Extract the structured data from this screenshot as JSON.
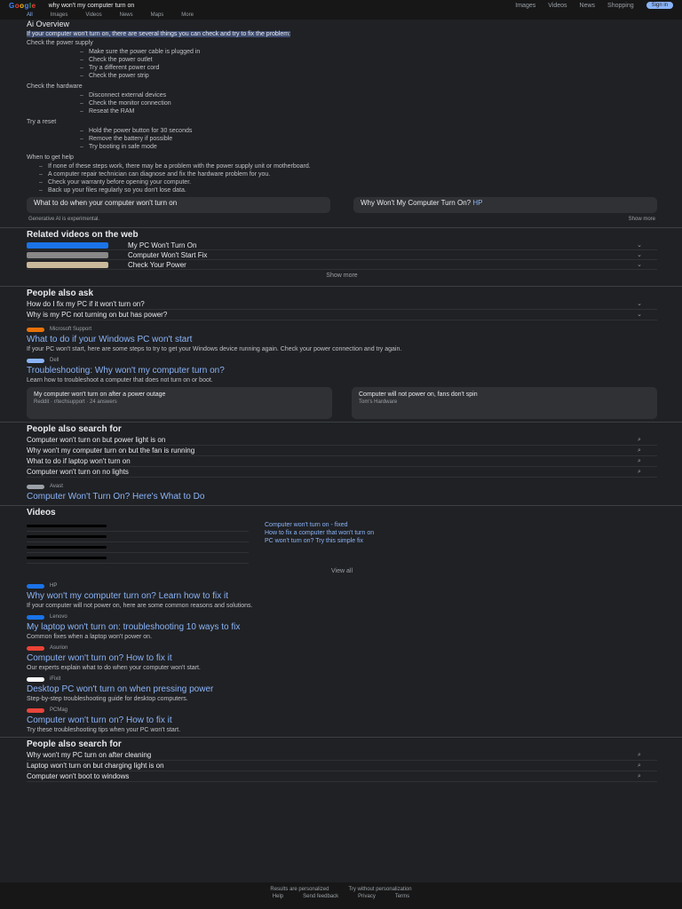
{
  "header": {
    "logo": [
      "G",
      "o",
      "o",
      "g",
      "l",
      "e"
    ],
    "query": "why won't my computer turn on",
    "nav": [
      "Images",
      "Videos",
      "News",
      "Shopping"
    ],
    "signin_label": "Sign in"
  },
  "tabs": [
    {
      "label": "All",
      "active": true
    },
    {
      "label": "Images",
      "active": false
    },
    {
      "label": "Videos",
      "active": false
    },
    {
      "label": "News",
      "active": false
    },
    {
      "label": "Maps",
      "active": false
    },
    {
      "label": "More",
      "active": false
    }
  ],
  "featured": {
    "lead": "Ai Overview",
    "highlight": "If your computer won't turn on, there are several things you can check and try to fix the problem:",
    "section1": "Check the power supply",
    "items1": [
      "Make sure the power cable is plugged in",
      "Check the power outlet",
      "Try a different power cord",
      "Check the power strip"
    ],
    "section2": "Check the hardware",
    "items2": [
      "Disconnect external devices",
      "Check the monitor connection",
      "Reseat the RAM"
    ],
    "section3": "Try a reset",
    "items3": [
      "Hold the power button for 30 seconds",
      "Remove the battery if possible",
      "Try booting in safe mode"
    ],
    "section4": "When to get help",
    "paras": [
      "If none of these steps work, there may be a problem with the power supply unit or motherboard.",
      "A computer repair technician can diagnose and fix the hardware problem for you.",
      "Check your warranty before opening your computer.",
      "Back up your files regularly so you don't lose data."
    ],
    "card1": "What to do when your computer won't turn on",
    "card2": "Why Won't My Computer Turn On?",
    "card2_sub": "HP",
    "feedback_left": "Generative AI is experimental.",
    "feedback_right": "Show more"
  },
  "sources": {
    "title": "Related videos on the web",
    "rows": [
      {
        "text": "My PC Won't Turn On",
        "color": "#1a73e8"
      },
      {
        "text": "Computer Won't Start Fix",
        "color": "#888888"
      },
      {
        "text": "Check Your Power",
        "color": "#c9b89a"
      }
    ],
    "more": "Show more"
  },
  "faq1": {
    "title": "People also ask",
    "qs": [
      "How do I fix my PC if it won't turn on?",
      "Why is my PC not turning on but has power?"
    ]
  },
  "results": [
    {
      "site": "Microsoft Support",
      "fav": "#e8710a",
      "title": "What to do if your Windows PC won't start",
      "snip": "If your PC won't start, here are some steps to try to get your Windows device running again. Check your power connection and try again."
    },
    {
      "site": "Dell",
      "fav": "#8ab4f8",
      "title": "Troubleshooting: Why won't my computer turn on?",
      "snip": "Learn how to troubleshoot a computer that does not turn on or boot."
    }
  ],
  "boxes": [
    {
      "t": "My computer won't turn on after a power outage",
      "s": "Reddit · r/techsupport · 24 answers"
    },
    {
      "t": "Computer will not power on, fans don't spin",
      "s": "Tom's Hardware"
    }
  ],
  "faq2": {
    "title": "People also search for",
    "qs": [
      "Computer won't turn on but power light is on",
      "Why won't my computer turn on but the fan is running",
      "What to do if laptop won't turn on",
      "Computer won't turn on no lights"
    ]
  },
  "result3": {
    "site": "Avast",
    "fav": "#9aa0a6",
    "title": "Computer Won't Turn On? Here's What to Do",
    "snip": ""
  },
  "videos": {
    "title": "Videos",
    "links": [
      "Computer won't turn on - fixed",
      "How to fix a computer that won't turn on",
      "PC won't turn on? Try this simple fix"
    ],
    "more": "View all"
  },
  "results2": [
    {
      "site": "HP",
      "fav": "#1a73e8",
      "title": "Why won't my computer turn on? Learn how to fix it",
      "snip": "If your computer will not power on, here are some common reasons and solutions."
    },
    {
      "site": "Lenovo",
      "fav": "#1a73e8",
      "title": "My laptop won't turn on: troubleshooting 10 ways to fix",
      "snip": "Common fixes when a laptop won't power on."
    },
    {
      "site": "Asurion",
      "fav": "#ea4335",
      "title": "Computer won't turn on? How to fix it",
      "snip": "Our experts explain what to do when your computer won't start."
    },
    {
      "site": "iFixit",
      "fav": "#ffffff",
      "title": "Desktop PC won't turn on when pressing power",
      "snip": "Step-by-step troubleshooting guide for desktop computers."
    },
    {
      "site": "PCMag",
      "fav": "#e8453c",
      "title": "Computer won't turn on? How to fix it",
      "snip": "Try these troubleshooting tips when your PC won't start."
    }
  ],
  "faq3": {
    "title": "People also search for",
    "qs": [
      "Why won't my PC turn on after cleaning",
      "Laptop won't turn on but charging light is on",
      "Computer won't boot to windows"
    ]
  },
  "footer": {
    "line1": [
      "Results are personalized",
      "Try without personalization"
    ],
    "line2": [
      "Help",
      "Send feedback",
      "Privacy",
      "Terms"
    ]
  }
}
